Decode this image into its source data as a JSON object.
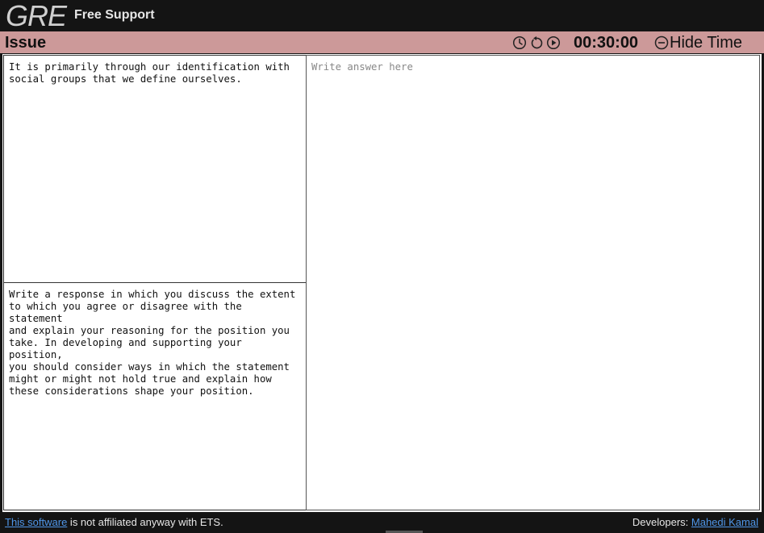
{
  "header": {
    "logo": "GRE",
    "subtitle": "Free Support"
  },
  "section": {
    "title": "Issue",
    "timer": "00:30:00",
    "hide_time_label": "Hide Time",
    "icons": [
      "clock-icon",
      "reset-icon",
      "play-icon",
      "minus-circle-icon"
    ]
  },
  "prompt": {
    "statement": "It is primarily through our identification with\nsocial groups that we define ourselves.",
    "instructions": "Write a response in which you discuss the extent\nto which you agree or disagree with the statement\nand explain your reasoning for the position you\ntake. In developing and supporting your position,\nyou should consider ways in which the statement\nmight or might not hold true and explain how\nthese considerations shape your position."
  },
  "answer": {
    "value": "",
    "placeholder": "Write answer here"
  },
  "footer": {
    "link_text": "This software",
    "disclaimer": " is not affiliated anyway with ETS.",
    "developers_label": "Developers: ",
    "developer_name": "Mahedi Kamal"
  }
}
